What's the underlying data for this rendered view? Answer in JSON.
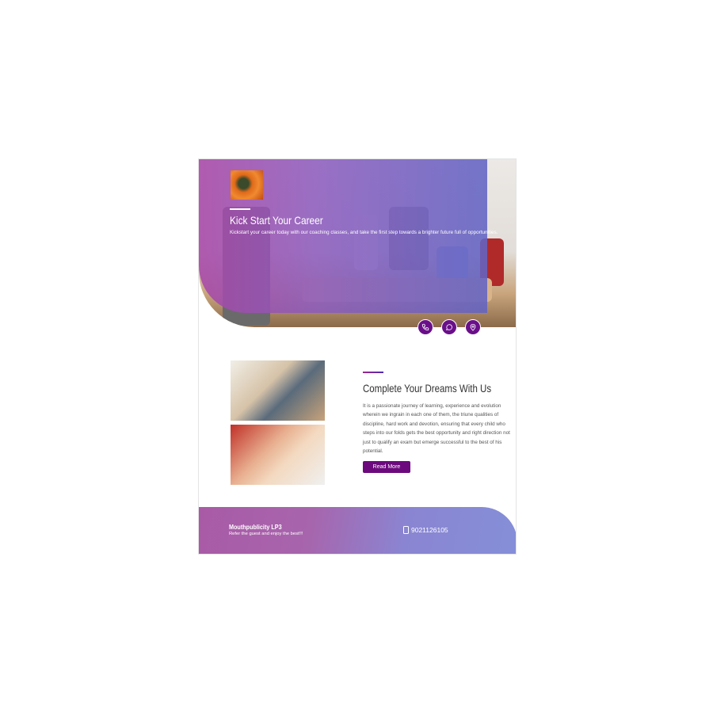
{
  "hero": {
    "title": "Kick Start Your Career",
    "subtitle": "Kickstart your career today with our coaching classes, and take the first step towards a brighter future full of opportunities."
  },
  "contact_icons": [
    "phone-icon",
    "whatsapp-icon",
    "location-pin-icon"
  ],
  "about": {
    "title": "Complete Your Dreams With Us",
    "body": "It is a passionate journey of learning, experience and evolution wherein we ingrain in each one of them, the triune qualities of discipline, hard work and devotion, ensuring that every child who steps into our folds gets the best opportunity and right direction not just to qualify an exam but emerge successful to the best of his potential.",
    "button": "Read More"
  },
  "footer": {
    "brand": "Mouthpublicity LP3",
    "tagline": "Refer the guest and enjoy the best!!!",
    "phone": "9021126105"
  },
  "colors": {
    "accent": "#6c0a7d",
    "gradient_start": "#a95aa6",
    "gradient_end": "#858fd8"
  }
}
